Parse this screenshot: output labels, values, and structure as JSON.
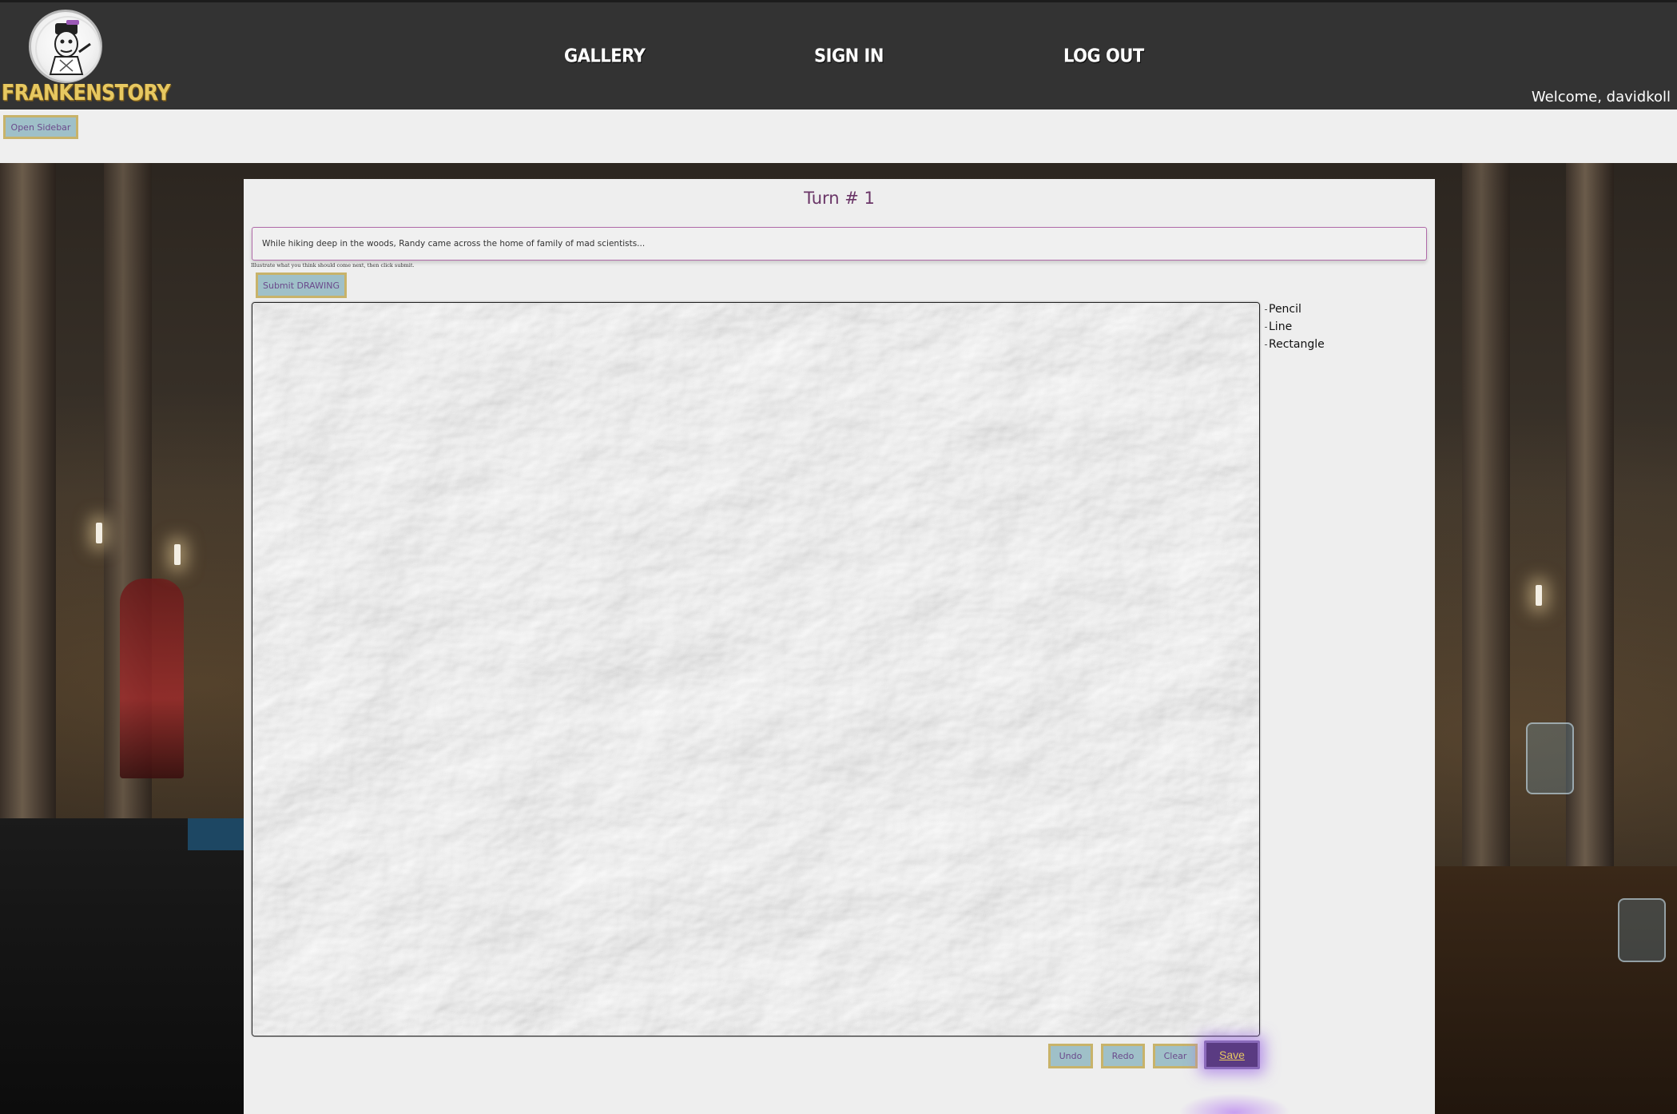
{
  "brand": {
    "name": "FRANKENSTORY",
    "logo_icon": "frankenstein-doodle-logo"
  },
  "nav": {
    "gallery": "GALLERY",
    "signin": "SIGN IN",
    "logout": "LOG OUT"
  },
  "user": {
    "welcome": "Welcome, davidkoll"
  },
  "sidebar": {
    "open_label": "Open Sidebar"
  },
  "game": {
    "turn_title": "Turn # 1",
    "prompt_text": "While hiking deep in the woods, Randy came across the home of family of mad scientists...",
    "hint": "Illustrate what you think should come next, then click submit.",
    "submit_label": "Submit DRAWING"
  },
  "tools": [
    "Pencil",
    "Line",
    "Rectangle"
  ],
  "actions": {
    "undo": "Undo",
    "redo": "Redo",
    "clear": "Clear",
    "save": "Save"
  },
  "colors": {
    "navbar": "#333333",
    "brand_gold": "#e7c861",
    "button_fill": "#9fc0c8",
    "button_border": "#c8b36a",
    "accent_purple": "#6a3567",
    "save_fill": "#5a3b82"
  }
}
